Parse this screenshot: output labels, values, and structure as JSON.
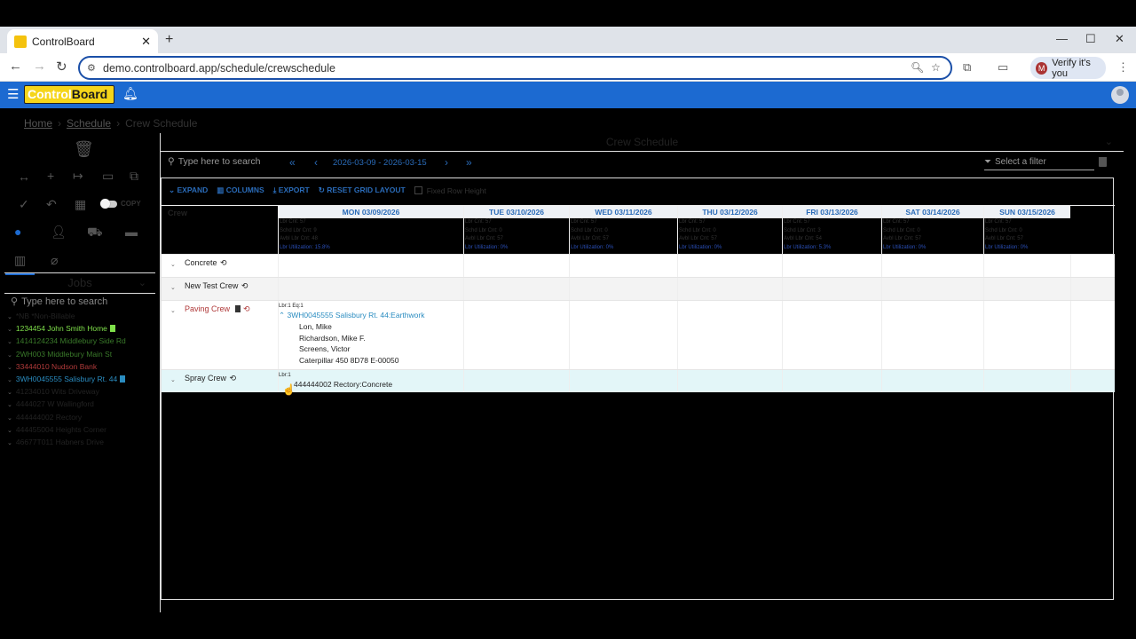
{
  "browser": {
    "tab_title": "ControlBoard",
    "url": "demo.controlboard.app/schedule/crewschedule",
    "verify_label": "Verify it's you",
    "verify_avatar": "M"
  },
  "app": {
    "logo_part1": "Control",
    "logo_part2": "Board"
  },
  "breadcrumb": {
    "home": "Home",
    "schedule": "Schedule",
    "current": "Crew Schedule"
  },
  "leftpanel": {
    "copy_label": "COPY",
    "jobs_title": "Jobs",
    "search_placeholder": "Type here to search",
    "jobs": [
      {
        "label": "*NB *Non-Billable",
        "color": "#222222",
        "doc": false
      },
      {
        "label": "1234454 John Smith Home",
        "color": "#7fe04a",
        "doc": true
      },
      {
        "label": "1414124234 Middlebury Side Rd",
        "color": "#3a7a2a",
        "doc": false
      },
      {
        "label": "2WH003 Middlebury Main St",
        "color": "#3a7a2a",
        "doc": false
      },
      {
        "label": "33444010 Nudson Bank",
        "color": "#b03a3a",
        "doc": false
      },
      {
        "label": "3WH0045555 Salisbury Rt. 44",
        "color": "#2a8cc0",
        "doc": true
      },
      {
        "label": "41234010 Wits Driveway",
        "color": "#222222",
        "doc": false
      },
      {
        "label": "4444027 W Wallingford",
        "color": "#222222",
        "doc": false
      },
      {
        "label": "444444002 Rectory",
        "color": "#222222",
        "doc": false
      },
      {
        "label": "444455004 Heights Corner",
        "color": "#222222",
        "doc": false
      },
      {
        "label": "46677T011 Habners Drive",
        "color": "#222222",
        "doc": false
      }
    ]
  },
  "main": {
    "title": "Crew Schedule",
    "search_placeholder": "Type here to search",
    "date_range": "2026-03-09 - 2026-03-15",
    "filter_placeholder": "Select a filter",
    "tools": {
      "expand": "EXPAND",
      "columns": "COLUMNS",
      "export": "EXPORT",
      "reset": "RESET GRID LAYOUT",
      "fixed_row": "Fixed Row Height"
    },
    "crew_header": "Crew",
    "days": [
      {
        "name": "MON 03/09/2026",
        "cnt": "Lbr Cnt: 57",
        "schd": "Schd Lbr Cnt: 9",
        "avbl": "Avbl Lbr Cnt: 48",
        "util": "Lbr Utilization: 15.8%"
      },
      {
        "name": "TUE 03/10/2026",
        "cnt": "Lbr Cnt: 57",
        "schd": "Schd Lbr Cnt: 0",
        "avbl": "Avbl Lbr Cnt: 57",
        "util": "Lbr Utilization: 0%"
      },
      {
        "name": "WED 03/11/2026",
        "cnt": "Lbr Cnt: 57",
        "schd": "Schd Lbr Cnt: 0",
        "avbl": "Avbl Lbr Cnt: 57",
        "util": "Lbr Utilization: 0%"
      },
      {
        "name": "THU 03/12/2026",
        "cnt": "Lbr Cnt: 57",
        "schd": "Schd Lbr Cnt: 0",
        "avbl": "Avbl Lbr Cnt: 57",
        "util": "Lbr Utilization: 0%"
      },
      {
        "name": "FRI 03/13/2026",
        "cnt": "Lbr Cnt: 57",
        "schd": "Schd Lbr Cnt: 3",
        "avbl": "Avbl Lbr Cnt: 54",
        "util": "Lbr Utilization: 5.3%"
      },
      {
        "name": "SAT 03/14/2026",
        "cnt": "Lbr Cnt: 57",
        "schd": "Schd Lbr Cnt: 0",
        "avbl": "Avbl Lbr Cnt: 57",
        "util": "Lbr Utilization: 0%"
      },
      {
        "name": "SUN 03/15/2026",
        "cnt": "Lbr Cnt: 57",
        "schd": "Schd Lbr Cnt: 0",
        "avbl": "Avbl Lbr Cnt: 57",
        "util": "Lbr Utilization: 0%"
      }
    ],
    "crews": [
      {
        "name": "Concrete",
        "color": "#222222"
      },
      {
        "name": "New Test Crew",
        "color": "#222222"
      },
      {
        "name": "Paving Crew",
        "color": "#b03a3a"
      },
      {
        "name": "Spray Crew",
        "color": "#222222"
      }
    ],
    "paving_assignment": {
      "counts": "Lbr:1 Eq:1",
      "job": "3WH0045555 Salisbury Rt. 44:Earthwork",
      "members": [
        "Lon, Mike",
        "Richardson, Mike F.",
        "Screens, Victor",
        "Caterpillar 450 8D78 E-00050"
      ]
    },
    "spray_assignment": {
      "counts": "Lbr:1",
      "job": "444444002 Rectory:Concrete"
    }
  }
}
